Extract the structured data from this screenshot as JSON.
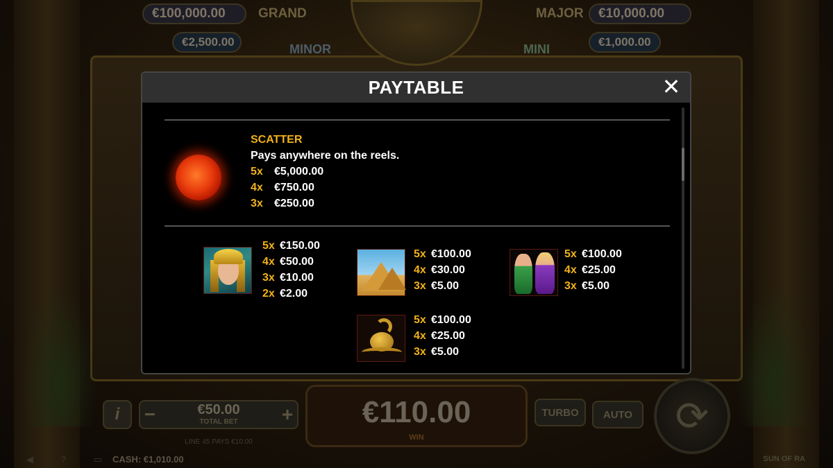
{
  "background": {
    "jackpots": {
      "grand": {
        "value": "€100,000.00",
        "label": "GRAND"
      },
      "major": {
        "value": "€10,000.00",
        "label": "MAJOR"
      },
      "minor": {
        "value": "€2,500.00",
        "label": "MINOR"
      },
      "mini": {
        "value": "€1,000.00",
        "label": "MINI"
      }
    },
    "console": {
      "info_label": "i",
      "bet_minus": "−",
      "bet_plus": "+",
      "total_bet_value": "€50.00",
      "total_bet_label": "TOTAL BET",
      "line_pays": "LINE 45 PAYS €10.00",
      "win_value": "€110.00",
      "win_label": "WIN",
      "turbo_label": "TURBO",
      "auto_label": "AUTO",
      "spin_glyph": "⟳",
      "cash": "CASH: €1,010.00",
      "game_title": "SUN OF RA",
      "bottom_icons": "◀ ? ▭"
    }
  },
  "paytable": {
    "title": "PAYTABLE",
    "close_glyph": "✕",
    "scatter": {
      "title": "SCATTER",
      "description": "Pays anywhere on the reels.",
      "pays": [
        {
          "mult": "5x",
          "amount": "€5,000.00"
        },
        {
          "mult": "4x",
          "amount": "€750.00"
        },
        {
          "mult": "3x",
          "amount": "€250.00"
        }
      ]
    },
    "symbols": [
      {
        "icon": "pharaoh-queen-icon",
        "pays": [
          {
            "mult": "5x",
            "amount": "€150.00"
          },
          {
            "mult": "4x",
            "amount": "€50.00"
          },
          {
            "mult": "3x",
            "amount": "€10.00"
          },
          {
            "mult": "2x",
            "amount": "€2.00"
          }
        ]
      },
      {
        "icon": "pyramids-icon",
        "pays": [
          {
            "mult": "5x",
            "amount": "€100.00"
          },
          {
            "mult": "4x",
            "amount": "€30.00"
          },
          {
            "mult": "3x",
            "amount": "€5.00"
          }
        ]
      },
      {
        "icon": "dancers-icon",
        "pays": [
          {
            "mult": "5x",
            "amount": "€100.00"
          },
          {
            "mult": "4x",
            "amount": "€25.00"
          },
          {
            "mult": "3x",
            "amount": "€5.00"
          }
        ]
      },
      {
        "icon": "scorpion-icon",
        "pays": [
          {
            "mult": "5x",
            "amount": "€100.00"
          },
          {
            "mult": "4x",
            "amount": "€25.00"
          },
          {
            "mult": "3x",
            "amount": "€5.00"
          }
        ]
      }
    ]
  },
  "colors": {
    "multiplier": "#f2b21a",
    "amount": "#ffffff",
    "header": "#303030",
    "sun": "#e83a0c"
  }
}
